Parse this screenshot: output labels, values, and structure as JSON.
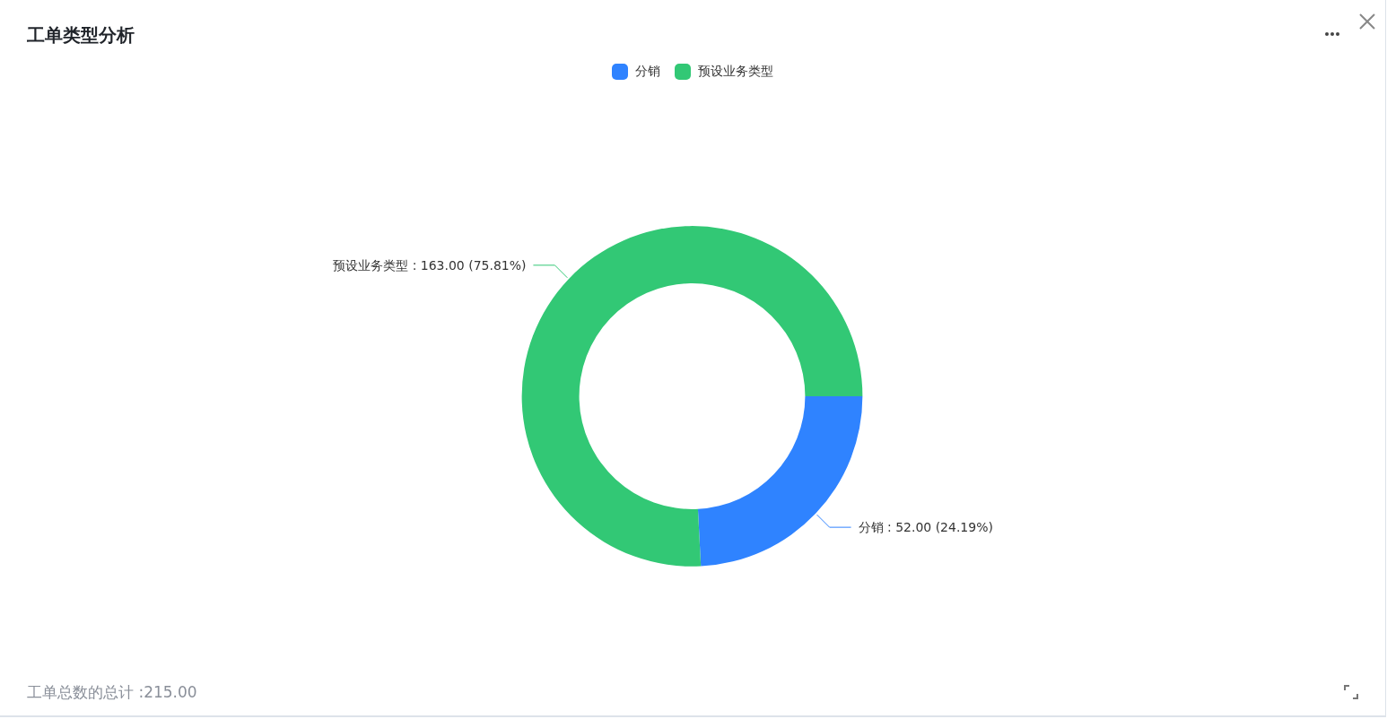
{
  "title": "工单类型分析",
  "legend": [
    {
      "color": "#2f83ff"
    },
    {
      "color": "#32c875"
    }
  ],
  "chart_data": {
    "type": "donut",
    "categories": [
      "分销",
      "预设业务类型"
    ],
    "values": [
      52,
      163
    ],
    "value_labels": [
      "分销 : 52.00 (24.19%)",
      "预设业务类型 : 163.00 (75.81%)"
    ]
  },
  "footer": "工单总数的总计 :215.00"
}
